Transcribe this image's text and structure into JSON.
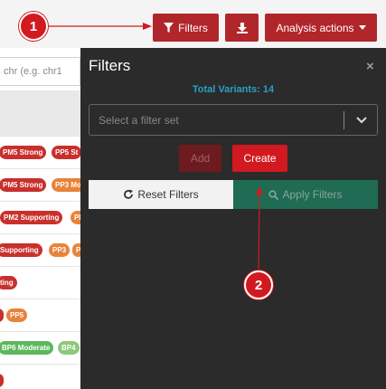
{
  "toolbar": {
    "filters_label": "Filters",
    "analysis_label": "Analysis actions"
  },
  "table": {
    "search_placeholder": "chr (e.g. chr1",
    "rows": [
      [
        "PM5 Strong",
        "PP5 St"
      ],
      [
        "PM5 Strong",
        "PP3 Mo"
      ],
      [
        "PM2 Supporting",
        "PP"
      ],
      [
        "Supporting",
        "PP3",
        "P"
      ],
      [
        "ting"
      ],
      [
        "",
        "PP5"
      ],
      [
        "BP6 Moderate",
        "BP4"
      ],
      [
        ""
      ]
    ]
  },
  "filters_panel": {
    "title": "Filters",
    "close_symbol": "×",
    "total_variants": "Total Variants: 14",
    "select_placeholder": "Select a filter set",
    "add_label": "Add",
    "create_label": "Create",
    "reset_label": "Reset Filters",
    "apply_label": "Apply Filters"
  },
  "annotations": {
    "marker_1": "1",
    "marker_2": "2"
  },
  "colors": {
    "brand_red": "#b1262b",
    "panel_bg": "#2b2b2b",
    "total_text": "#28a1c5",
    "apply_bg": "#1f6b53"
  }
}
